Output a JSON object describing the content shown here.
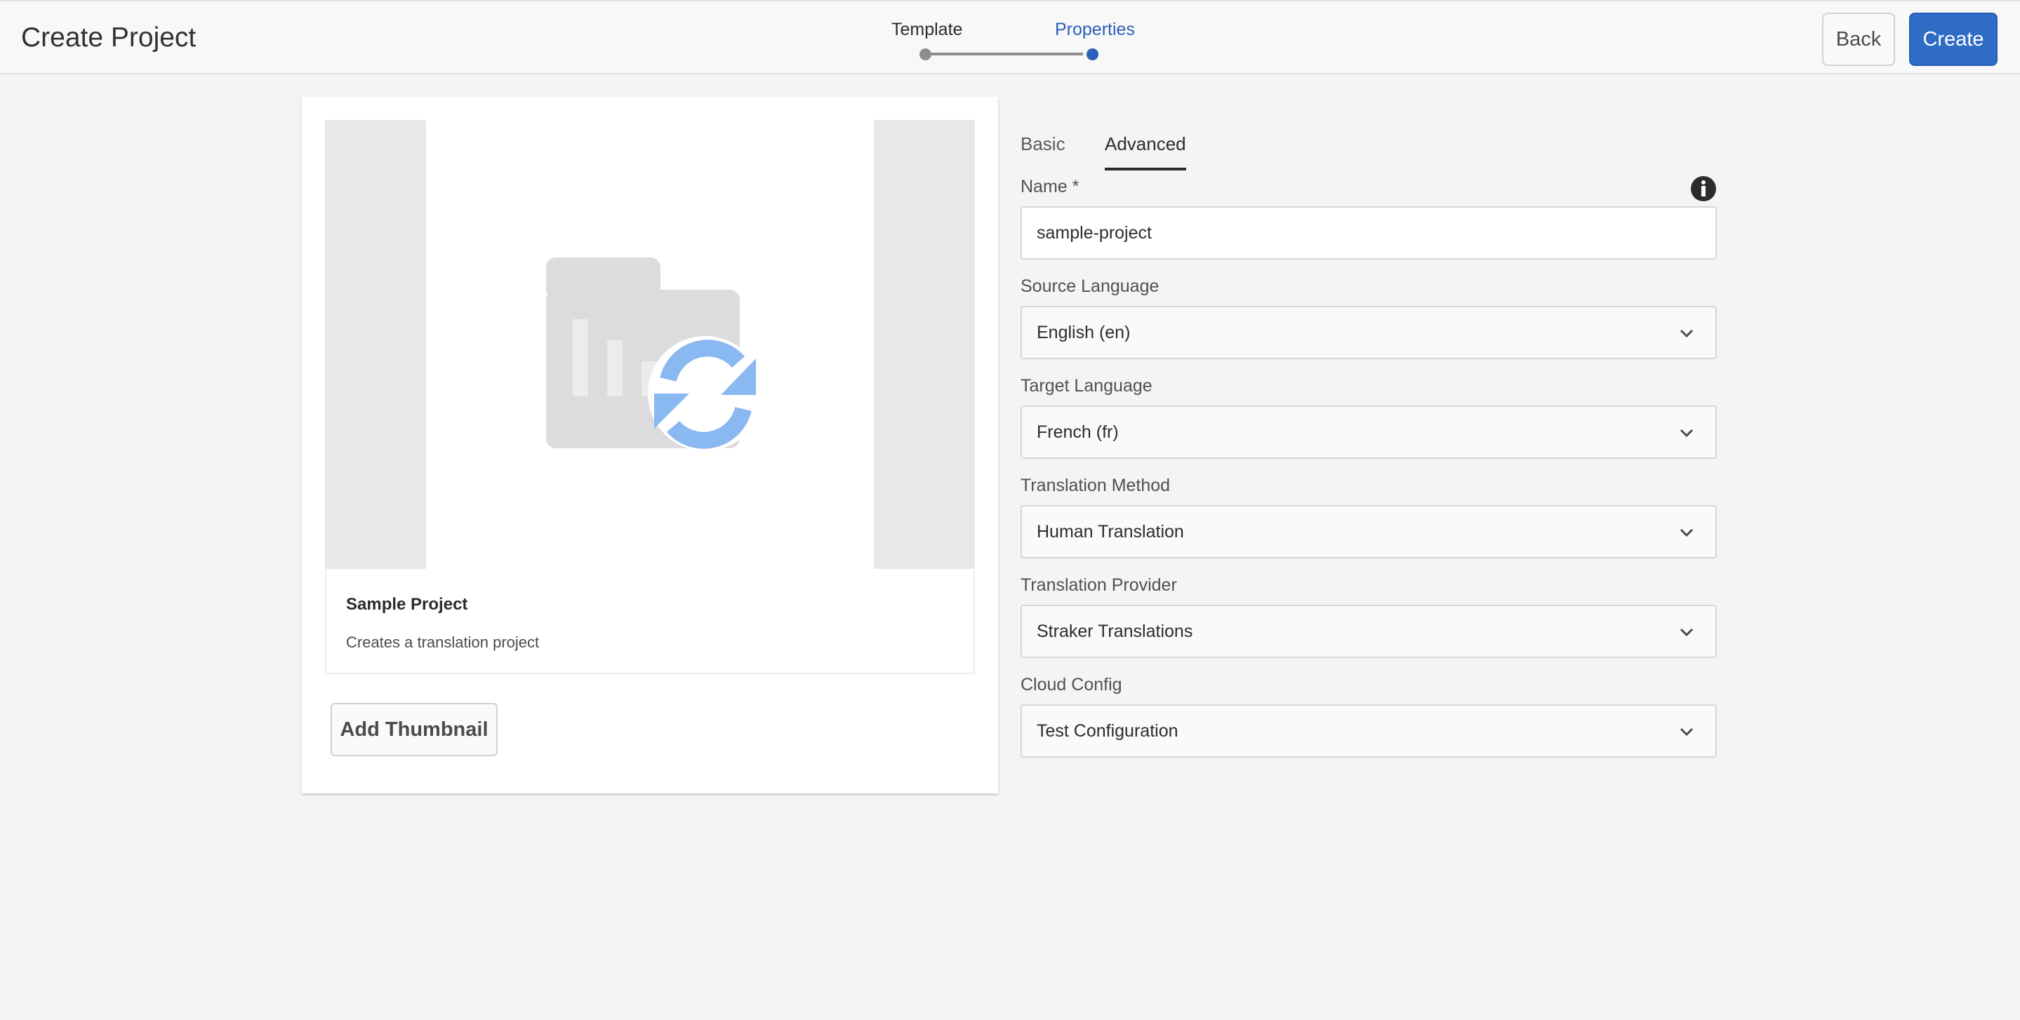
{
  "header": {
    "title": "Create Project",
    "steps": [
      {
        "label": "Template",
        "state": "complete"
      },
      {
        "label": "Properties",
        "state": "current"
      }
    ],
    "back_label": "Back",
    "create_label": "Create"
  },
  "template_card": {
    "title": "Sample Project",
    "description": "Creates a translation project",
    "thumbnail_icon": "translation-folder-icon",
    "add_thumbnail_label": "Add Thumbnail"
  },
  "tabs": [
    {
      "label": "Basic",
      "active": false
    },
    {
      "label": "Advanced",
      "active": true
    }
  ],
  "fields": {
    "name": {
      "label": "Name *",
      "value": "sample-project"
    },
    "source_language": {
      "label": "Source Language",
      "value": "English (en)"
    },
    "target_language": {
      "label": "Target Language",
      "value": "French (fr)"
    },
    "translation_method": {
      "label": "Translation Method",
      "value": "Human Translation"
    },
    "translation_provider": {
      "label": "Translation Provider",
      "value": "Straker Translations"
    },
    "cloud_config": {
      "label": "Cloud Config",
      "value": "Test Configuration"
    }
  },
  "colors": {
    "accent": "#2e6cc6",
    "active_step": "#2c5fb7",
    "sync_icon": "#8ab8f0"
  }
}
